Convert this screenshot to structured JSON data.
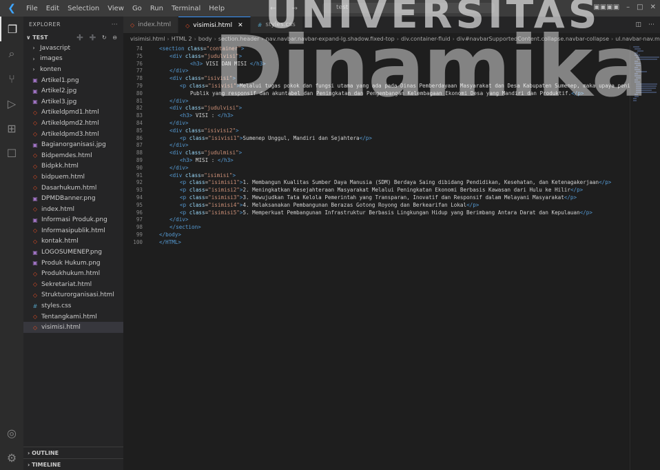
{
  "titlebar": {
    "menu": [
      "File",
      "Edit",
      "Selection",
      "View",
      "Go",
      "Run",
      "Terminal",
      "Help"
    ],
    "nav": "← →",
    "search": "test"
  },
  "sidebar": {
    "header": "EXPLORER",
    "menu_glyph": "···",
    "folder": "TEST",
    "folder_actions": "➕ ➕ ↻ ⊖",
    "files": [
      {
        "name": "Javascript",
        "type": "folder"
      },
      {
        "name": "images",
        "type": "folder"
      },
      {
        "name": "konten",
        "type": "folder"
      },
      {
        "name": "Artikel1.png",
        "type": "png"
      },
      {
        "name": "Artikel2.jpg",
        "type": "png"
      },
      {
        "name": "Artikel3.jpg",
        "type": "png"
      },
      {
        "name": "Artikeldpmd1.html",
        "type": "html"
      },
      {
        "name": "Artikeldpmd2.html",
        "type": "html"
      },
      {
        "name": "Artikeldpmd3.html",
        "type": "html"
      },
      {
        "name": "Bagianorganisasi.jpg",
        "type": "png"
      },
      {
        "name": "Bidpemdes.html",
        "type": "html"
      },
      {
        "name": "Bidpkk.html",
        "type": "html"
      },
      {
        "name": "bidpuem.html",
        "type": "html"
      },
      {
        "name": "Dasarhukum.html",
        "type": "html"
      },
      {
        "name": "DPMDBanner.png",
        "type": "png"
      },
      {
        "name": "index.html",
        "type": "html"
      },
      {
        "name": "Informasi Produk.png",
        "type": "png"
      },
      {
        "name": "Informasipublik.html",
        "type": "html"
      },
      {
        "name": "kontak.html",
        "type": "html"
      },
      {
        "name": "LOGOSUMENEP.png",
        "type": "png"
      },
      {
        "name": "Produk Hukum.png",
        "type": "png"
      },
      {
        "name": "Produkhukum.html",
        "type": "html"
      },
      {
        "name": "Sekretariat.html",
        "type": "html"
      },
      {
        "name": "Strukturorganisasi.html",
        "type": "html"
      },
      {
        "name": "styles.css",
        "type": "css"
      },
      {
        "name": "Tentangkami.html",
        "type": "html"
      },
      {
        "name": "visimisi.html",
        "type": "html",
        "active": true
      }
    ],
    "outline": "OUTLINE",
    "timeline": "TIMELINE"
  },
  "tabs": [
    {
      "label": "index.html",
      "active": false
    },
    {
      "label": "visimisi.html",
      "active": true
    },
    {
      "label": "styles.css",
      "active": false
    }
  ],
  "tab_close": "✕",
  "breadcrumb": [
    "visimisi.html",
    "HTML 2",
    "body",
    "section.header",
    "nav.navbar.navbar-expand-lg.shadow.fixed-top",
    "div.container-fluid",
    "div#navbarSupportedContent.collapse.navbar-collapse",
    "ul.navbar-nav.ms-auto.mb-2.mb-lg"
  ],
  "code_lines": [
    {
      "n": "74",
      "i": 0,
      "t": [
        [
          "tg",
          "<section "
        ],
        [
          "at",
          "class"
        ],
        [
          "tx",
          "="
        ],
        [
          "st",
          "\"container\""
        ],
        [
          "tg",
          ">"
        ]
      ]
    },
    {
      "n": "75",
      "i": 1,
      "t": [
        [
          "tg",
          "<div "
        ],
        [
          "at",
          "class"
        ],
        [
          "tx",
          "="
        ],
        [
          "st",
          "\"judulvisi\""
        ],
        [
          "tg",
          ">"
        ]
      ]
    },
    {
      "n": "76",
      "i": 3,
      "t": [
        [
          "tg",
          "<h3>"
        ],
        [
          "tx",
          " VISI DAN MISI "
        ],
        [
          "tg",
          "</h3>"
        ]
      ]
    },
    {
      "n": "77",
      "i": 1,
      "t": [
        [
          "tg",
          "</div>"
        ]
      ]
    },
    {
      "n": "78",
      "i": 1,
      "t": [
        [
          "tg",
          "<div "
        ],
        [
          "at",
          "class"
        ],
        [
          "tx",
          "="
        ],
        [
          "st",
          "\"isivisi\""
        ],
        [
          "tg",
          ">"
        ]
      ]
    },
    {
      "n": "79",
      "i": 2,
      "t": [
        [
          "tg",
          "<p "
        ],
        [
          "at",
          "class"
        ],
        [
          "tx",
          "="
        ],
        [
          "st",
          "\"isivisi\""
        ],
        [
          "tg",
          ">"
        ],
        [
          "tx",
          "Melalui tugas pokok dan fungsi utama yang ada pada Dinas Pemberdayaan Masyarakat dan Desa Kabupaten Sumenep, maka upaya peningkatan"
        ]
      ]
    },
    {
      "n": "80",
      "i": 3,
      "t": [
        [
          "tx",
          "Publik yang responsif dan akuntabel dan Peningkatan dan Pengembangan Kelembagaan Ekonomi Desa yang Mandiri dan Produktif."
        ],
        [
          "tg",
          "</p>"
        ]
      ]
    },
    {
      "n": "81",
      "i": 1,
      "t": [
        [
          "tg",
          "</div>"
        ]
      ]
    },
    {
      "n": "82",
      "i": 1,
      "t": [
        [
          "tg",
          "<div "
        ],
        [
          "at",
          "class"
        ],
        [
          "tx",
          "="
        ],
        [
          "st",
          "\"judulvisi\""
        ],
        [
          "tg",
          ">"
        ]
      ]
    },
    {
      "n": "83",
      "i": 2,
      "t": [
        [
          "tg",
          "<h3>"
        ],
        [
          "tx",
          " VISI : "
        ],
        [
          "tg",
          "</h3>"
        ]
      ]
    },
    {
      "n": "84",
      "i": 1,
      "t": [
        [
          "tg",
          "</div>"
        ]
      ]
    },
    {
      "n": "85",
      "i": 1,
      "t": [
        [
          "tg",
          "<div "
        ],
        [
          "at",
          "class"
        ],
        [
          "tx",
          "="
        ],
        [
          "st",
          "\"isivisi2\""
        ],
        [
          "tg",
          ">"
        ]
      ]
    },
    {
      "n": "86",
      "i": 2,
      "t": [
        [
          "tg",
          "<p "
        ],
        [
          "at",
          "class"
        ],
        [
          "tx",
          "="
        ],
        [
          "st",
          "\"isivisi1\""
        ],
        [
          "tg",
          ">"
        ],
        [
          "tx",
          "Sumenep Unggul, Mandiri dan Sejahtera"
        ],
        [
          "tg",
          "</p>"
        ]
      ]
    },
    {
      "n": "87",
      "i": 1,
      "t": [
        [
          "tg",
          "</div>"
        ]
      ]
    },
    {
      "n": "88",
      "i": 1,
      "t": [
        [
          "tg",
          "<div "
        ],
        [
          "at",
          "class"
        ],
        [
          "tx",
          "="
        ],
        [
          "st",
          "\"judulmisi\""
        ],
        [
          "tg",
          ">"
        ]
      ]
    },
    {
      "n": "89",
      "i": 2,
      "t": [
        [
          "tg",
          "<h3>"
        ],
        [
          "tx",
          " MISI : "
        ],
        [
          "tg",
          "</h3>"
        ]
      ]
    },
    {
      "n": "90",
      "i": 1,
      "t": [
        [
          "tg",
          "</div>"
        ]
      ]
    },
    {
      "n": "91",
      "i": 1,
      "t": [
        [
          "tg",
          "<div "
        ],
        [
          "at",
          "class"
        ],
        [
          "tx",
          "="
        ],
        [
          "st",
          "\"isimisi\""
        ],
        [
          "tg",
          ">"
        ]
      ]
    },
    {
      "n": "92",
      "i": 2,
      "t": [
        [
          "tg",
          "<p "
        ],
        [
          "at",
          "class"
        ],
        [
          "tx",
          "="
        ],
        [
          "st",
          "\"isimisi1\""
        ],
        [
          "tg",
          ">"
        ],
        [
          "tx",
          "1. Membangun Kualitas Sumber Daya Manusia (SDM) Berdaya Saing dibidang Pendidikan, Kesehatan, dan Ketenagakerjaan"
        ],
        [
          "tg",
          "</p>"
        ]
      ]
    },
    {
      "n": "93",
      "i": 2,
      "t": [
        [
          "tg",
          "<p "
        ],
        [
          "at",
          "class"
        ],
        [
          "tx",
          "="
        ],
        [
          "st",
          "\"isimisi2\""
        ],
        [
          "tg",
          ">"
        ],
        [
          "tx",
          "2. Meningkatkan Kesejahteraan Masyarakat Melalui Peningkatan Ekonomi Berbasis Kawasan dari Hulu ke Hilir"
        ],
        [
          "tg",
          "</p>"
        ]
      ]
    },
    {
      "n": "94",
      "i": 2,
      "t": [
        [
          "tg",
          "<p "
        ],
        [
          "at",
          "class"
        ],
        [
          "tx",
          "="
        ],
        [
          "st",
          "\"isimisi3\""
        ],
        [
          "tg",
          ">"
        ],
        [
          "tx",
          "3. Mewujudkan Tata Kelola Pemerintah yang Transparan, Inovatif dan Responsif dalam Melayani Masyarakat"
        ],
        [
          "tg",
          "</p>"
        ]
      ]
    },
    {
      "n": "95",
      "i": 2,
      "t": [
        [
          "tg",
          "<p "
        ],
        [
          "at",
          "class"
        ],
        [
          "tx",
          "="
        ],
        [
          "st",
          "\"isimisi4\""
        ],
        [
          "tg",
          ">"
        ],
        [
          "tx",
          "4. Melaksanakan Pembangunan Berazas Gotong Royong dan Berkearifan Lokal"
        ],
        [
          "tg",
          "</p>"
        ]
      ]
    },
    {
      "n": "96",
      "i": 2,
      "t": [
        [
          "tg",
          "<p "
        ],
        [
          "at",
          "class"
        ],
        [
          "tx",
          "="
        ],
        [
          "st",
          "\"isimisi5\""
        ],
        [
          "tg",
          ">"
        ],
        [
          "tx",
          "5. Memperkuat Pembangunan Infrastruktur Berbasis Lingkungan Hidup yang Berimbang Antara Darat dan Kepulauan"
        ],
        [
          "tg",
          "</p>"
        ]
      ]
    },
    {
      "n": "97",
      "i": 1,
      "t": [
        [
          "tg",
          "</div>"
        ]
      ]
    },
    {
      "n": "98",
      "i": 1,
      "t": [
        [
          "tg",
          "</section>"
        ]
      ]
    },
    {
      "n": "99",
      "i": 0,
      "t": [
        [
          "tg",
          "</body>"
        ]
      ]
    },
    {
      "n": "100",
      "i": 0,
      "t": [
        [
          "tg",
          "</HTML>"
        ]
      ]
    }
  ],
  "watermark": {
    "top": "UNIVERSITAS",
    "big": "Dinamika"
  },
  "icons": {
    "activity": [
      "files-icon",
      "search-icon",
      "source-control-icon",
      "run-debug-icon",
      "extensions-icon",
      "bookmark-icon"
    ],
    "bottom": [
      "account-icon",
      "settings-gear-icon"
    ]
  }
}
